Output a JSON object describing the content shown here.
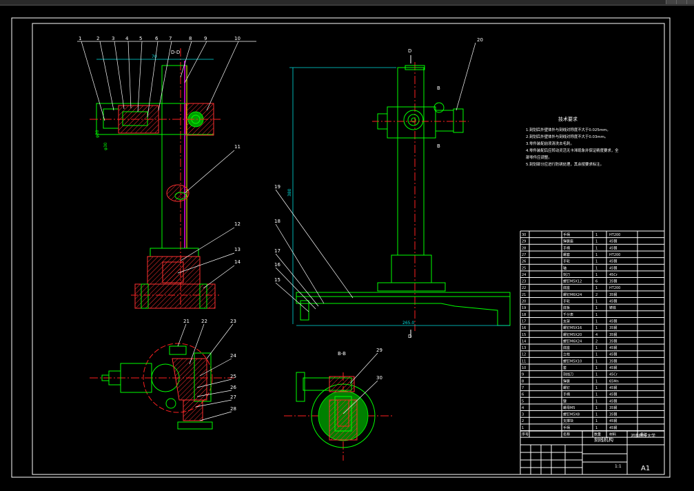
{
  "drawing": {
    "section_dd": "D-D",
    "section_bb": "B-B",
    "section_mark_d": "D",
    "section_mark_b": "B",
    "tech_title": "技术要求",
    "tech_lines": [
      "1.刻划后外壁体外与刻线对称度不大于0.025mm。",
      "2.刻划后外壁体外与刻线对称度不大于0.03mm。",
      "3.零件装配前须清洗去毛刺。",
      "4.零件装配后应转动灵活无卡滞现象并保证精度要求，全",
      "  部零件应调整。",
      "5.刻划部分应进行防锈处理，其余按要求标注。"
    ],
    "dims": {
      "height": "380",
      "base_width": "265.0"
    },
    "balloons_left": [
      "1",
      "2",
      "3",
      "4",
      "5",
      "6",
      "7",
      "8",
      "9",
      "10",
      "11",
      "12",
      "13",
      "14"
    ],
    "balloons_right": [
      "20",
      "19",
      "18",
      "17",
      "16",
      "15"
    ],
    "balloons_bottom": [
      "21",
      "22",
      "23",
      "24",
      "25",
      "26",
      "27",
      "28",
      "29",
      "30"
    ]
  },
  "title_block": {
    "title": "刻线机构",
    "school": "河南科技大学",
    "scale": "1:1",
    "sheet_label": "A1"
  },
  "parts_list": [
    {
      "no": "30",
      "name": "手柄",
      "qty": "1",
      "mat": "HT200",
      "note": ""
    },
    {
      "no": "29",
      "name": "弹簧座",
      "qty": "1",
      "mat": "45钢",
      "note": ""
    },
    {
      "no": "28",
      "name": "手柄",
      "qty": "1",
      "mat": "45钢",
      "note": ""
    },
    {
      "no": "27",
      "name": "螺套",
      "qty": "1",
      "mat": "HT200",
      "note": ""
    },
    {
      "no": "26",
      "name": "手轮",
      "qty": "1",
      "mat": "45钢",
      "note": ""
    },
    {
      "no": "25",
      "name": "轴",
      "qty": "1",
      "mat": "45钢",
      "note": ""
    },
    {
      "no": "24",
      "name": "刻刀",
      "qty": "1",
      "mat": "45Cr",
      "note": ""
    },
    {
      "no": "23",
      "name": "螺钉M5X12",
      "qty": "6",
      "mat": "35钢",
      "note": ""
    },
    {
      "no": "22",
      "name": "底座",
      "qty": "1",
      "mat": "HT200",
      "note": ""
    },
    {
      "no": "21",
      "name": "螺钉M6X24",
      "qty": "2",
      "mat": "35钢",
      "note": ""
    },
    {
      "no": "20",
      "name": "手轮",
      "qty": "1",
      "mat": "45钢",
      "note": ""
    },
    {
      "no": "19",
      "name": "底板",
      "qty": "1",
      "mat": "铸铁",
      "note": ""
    },
    {
      "no": "18",
      "name": "千分表",
      "qty": "1",
      "mat": "",
      "note": ""
    },
    {
      "no": "17",
      "name": "支架",
      "qty": "1",
      "mat": "45钢",
      "note": ""
    },
    {
      "no": "16",
      "name": "螺钉M5X16",
      "qty": "1",
      "mat": "35钢",
      "note": ""
    },
    {
      "no": "15",
      "name": "螺钉M5X20",
      "qty": "4",
      "mat": "35钢",
      "note": ""
    },
    {
      "no": "14",
      "name": "螺钉M6X24",
      "qty": "2",
      "mat": "35钢",
      "note": ""
    },
    {
      "no": "13",
      "name": "底座",
      "qty": "1",
      "mat": "45钢",
      "note": ""
    },
    {
      "no": "12",
      "name": "立柱",
      "qty": "1",
      "mat": "45钢",
      "note": ""
    },
    {
      "no": "11",
      "name": "螺钉M5X10",
      "qty": "1",
      "mat": "35钢",
      "note": ""
    },
    {
      "no": "10",
      "name": "套",
      "qty": "1",
      "mat": "45钢",
      "note": ""
    },
    {
      "no": "9",
      "name": "刻线刀",
      "qty": "1",
      "mat": "45Cr",
      "note": ""
    },
    {
      "no": "8",
      "name": "弹簧",
      "qty": "1",
      "mat": "65Mn",
      "note": ""
    },
    {
      "no": "7",
      "name": "螺钉",
      "qty": "1",
      "mat": "45钢",
      "note": ""
    },
    {
      "no": "6",
      "name": "手柄",
      "qty": "1",
      "mat": "45钢",
      "note": ""
    },
    {
      "no": "5",
      "name": "键",
      "qty": "1",
      "mat": "45钢",
      "note": ""
    },
    {
      "no": "4",
      "name": "螺母M5",
      "qty": "1",
      "mat": "35钢",
      "note": ""
    },
    {
      "no": "3",
      "name": "螺钉M5X8",
      "qty": "1",
      "mat": "35钢",
      "note": ""
    },
    {
      "no": "2",
      "name": "支撑块",
      "qty": "1",
      "mat": "45钢",
      "note": ""
    },
    {
      "no": "1",
      "name": "手柄",
      "qty": "1",
      "mat": "45钢",
      "note": ""
    }
  ],
  "parts_header": {
    "no": "序号",
    "name": "名称",
    "qty": "数量",
    "mat": "材料",
    "note": "备注"
  }
}
